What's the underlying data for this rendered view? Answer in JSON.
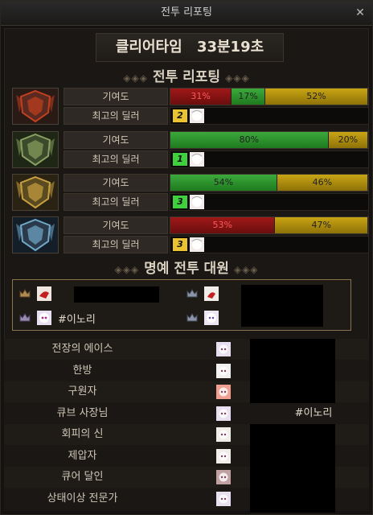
{
  "window": {
    "title": "전투 리포팅",
    "close_icon": "close-icon"
  },
  "clear_time": {
    "label": "클리어타임",
    "value": "33분19초"
  },
  "section_report": {
    "title": "전투 리포팅"
  },
  "labels": {
    "contribution": "기여도",
    "top_dealer": "최고의 딜러"
  },
  "parties": [
    {
      "emblem": "red-shield-emblem",
      "segments": [
        {
          "label": "31%",
          "value": 31,
          "color": "red"
        },
        {
          "label": "17%",
          "value": 17,
          "color": "green"
        },
        {
          "label": "52%",
          "value": 52,
          "color": "yellow"
        }
      ],
      "dealer_rank": "2",
      "dealer_rank_color": "#eac232"
    },
    {
      "emblem": "green-shield-emblem",
      "segments": [
        {
          "label": "80%",
          "value": 80,
          "color": "green"
        },
        {
          "label": "20%",
          "value": 20,
          "color": "yellow"
        }
      ],
      "dealer_rank": "1",
      "dealer_rank_color": "#3fcf3f"
    },
    {
      "emblem": "gold-shield-emblem",
      "segments": [
        {
          "label": "54%",
          "value": 54,
          "color": "green"
        },
        {
          "label": "46%",
          "value": 46,
          "color": "yellow"
        }
      ],
      "dealer_rank": "3",
      "dealer_rank_color": "#3fcf3f"
    },
    {
      "emblem": "blue-shield-emblem",
      "segments": [
        {
          "label": "53%",
          "value": 53,
          "color": "red"
        },
        {
          "label": "47%",
          "value": 47,
          "color": "yellow"
        }
      ],
      "dealer_rank": "3",
      "dealer_rank_color": "#eac232"
    }
  ],
  "section_honor": {
    "title": "명예 전투 대원"
  },
  "honor_members": [
    {
      "name": ""
    },
    {
      "name": "#이노리"
    },
    {
      "name": ""
    },
    {
      "name": ""
    }
  ],
  "awards": [
    {
      "title": "전장의 에이스",
      "person": ""
    },
    {
      "title": "한방",
      "person": ""
    },
    {
      "title": "구원자",
      "person": ""
    },
    {
      "title": "큐브 사장님",
      "person": "#이노리"
    },
    {
      "title": "회피의 신",
      "person": ""
    },
    {
      "title": "제압자",
      "person": ""
    },
    {
      "title": "큐어 달인",
      "person": ""
    },
    {
      "title": "상태이상 전문가",
      "person": ""
    }
  ]
}
